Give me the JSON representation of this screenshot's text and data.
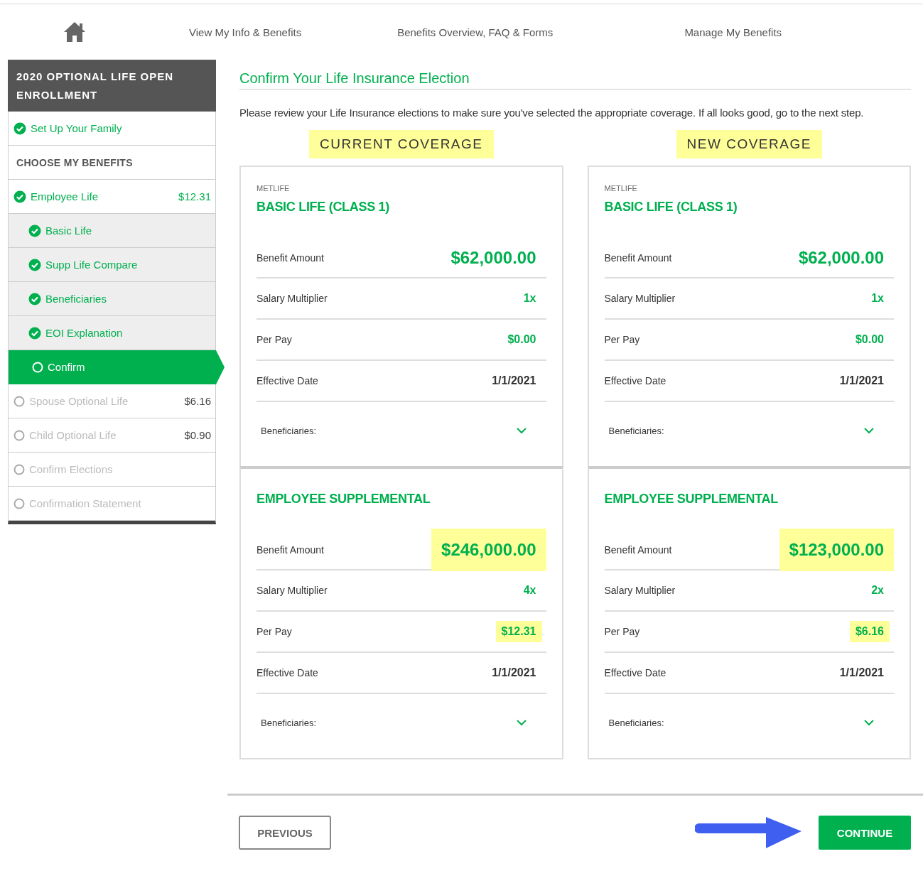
{
  "nav": {
    "links": [
      "View My Info & Benefits",
      "Benefits Overview, FAQ & Forms",
      "Manage My Benefits"
    ]
  },
  "sidebar": {
    "title": "2020 OPTIONAL LIFE OPEN ENROLLMENT",
    "items": [
      {
        "kind": "step",
        "label": "Set Up Your Family",
        "done": true,
        "selected": false
      },
      {
        "kind": "section",
        "label": "CHOOSE MY BENEFITS"
      },
      {
        "kind": "step",
        "label": "Employee Life",
        "done": true,
        "amount": "$12.31",
        "selected": false,
        "children": [
          {
            "kind": "step",
            "label": "Basic Life",
            "done": true,
            "selected": false
          },
          {
            "kind": "step",
            "label": "Supp Life Compare",
            "done": true,
            "selected": false
          },
          {
            "kind": "step",
            "label": "Beneficiaries",
            "done": true,
            "selected": false
          },
          {
            "kind": "step",
            "label": "EOI Explanation",
            "done": true,
            "selected": false
          },
          {
            "kind": "step",
            "label": "Confirm",
            "done": false,
            "selected": true
          }
        ]
      },
      {
        "kind": "step",
        "label": "Spouse Optional Life",
        "done": false,
        "amount": "$6.16",
        "selected": false
      },
      {
        "kind": "step",
        "label": "Child Optional Life",
        "done": false,
        "amount": "$0.90",
        "selected": false
      },
      {
        "kind": "step",
        "label": "Confirm Elections",
        "done": false,
        "selected": false
      },
      {
        "kind": "step",
        "label": "Confirmation Statement",
        "done": false,
        "selected": false
      }
    ]
  },
  "main": {
    "title": "Confirm Your Life Insurance Election",
    "intro": "Please review your Life Insurance elections to make sure you've selected the appropriate coverage. If all looks good, go to the next step.",
    "columns": [
      {
        "heading": "CURRENT COVERAGE",
        "highlighted": true,
        "plans": [
          {
            "carrier": "METLIFE",
            "name": "BASIC LIFE (CLASS 1)",
            "rows": [
              {
                "kind": "amount",
                "label": "Benefit Amount",
                "value": "$62,000.00",
                "highlighted": false
              },
              {
                "kind": "green",
                "label": "Salary Multiplier",
                "value": "1x",
                "highlighted": false
              },
              {
                "kind": "green",
                "label": "Per Pay",
                "value": "$0.00",
                "highlighted": false
              },
              {
                "kind": "plain",
                "label": "Effective Date",
                "value": "1/1/2021",
                "highlighted": false
              }
            ],
            "beneficiaries": "Beneficiaries:",
            "expanded": false
          },
          {
            "name": "EMPLOYEE SUPPLEMENTAL",
            "rows": [
              {
                "kind": "amount",
                "label": "Benefit Amount",
                "value": "$246,000.00",
                "highlighted": true
              },
              {
                "kind": "green",
                "label": "Salary Multiplier",
                "value": "4x",
                "highlighted": false
              },
              {
                "kind": "green",
                "label": "Per Pay",
                "value": "$12.31",
                "highlighted": true
              },
              {
                "kind": "plain",
                "label": "Effective Date",
                "value": "1/1/2021",
                "highlighted": false
              }
            ],
            "beneficiaries": "Beneficiaries:",
            "expanded": false
          }
        ]
      },
      {
        "heading": "NEW COVERAGE",
        "highlighted": true,
        "plans": [
          {
            "carrier": "METLIFE",
            "name": "BASIC LIFE (CLASS 1)",
            "rows": [
              {
                "kind": "amount",
                "label": "Benefit Amount",
                "value": "$62,000.00",
                "highlighted": false
              },
              {
                "kind": "green",
                "label": "Salary Multiplier",
                "value": "1x",
                "highlighted": false
              },
              {
                "kind": "green",
                "label": "Per Pay",
                "value": "$0.00",
                "highlighted": false
              },
              {
                "kind": "plain",
                "label": "Effective Date",
                "value": "1/1/2021",
                "highlighted": false
              }
            ],
            "beneficiaries": "Beneficiaries:",
            "expanded": false
          },
          {
            "name": "EMPLOYEE SUPPLEMENTAL",
            "rows": [
              {
                "kind": "amount",
                "label": "Benefit Amount",
                "value": "$123,000.00",
                "highlighted": true
              },
              {
                "kind": "green",
                "label": "Salary Multiplier",
                "value": "2x",
                "highlighted": false
              },
              {
                "kind": "green",
                "label": "Per Pay",
                "value": "$6.16",
                "highlighted": true
              },
              {
                "kind": "plain",
                "label": "Effective Date",
                "value": "1/1/2021",
                "highlighted": false
              }
            ],
            "beneficiaries": "Beneficiaries:",
            "expanded": false
          }
        ]
      }
    ]
  },
  "footer": {
    "previous": "PREVIOUS",
    "continue": "CONTINUE"
  }
}
